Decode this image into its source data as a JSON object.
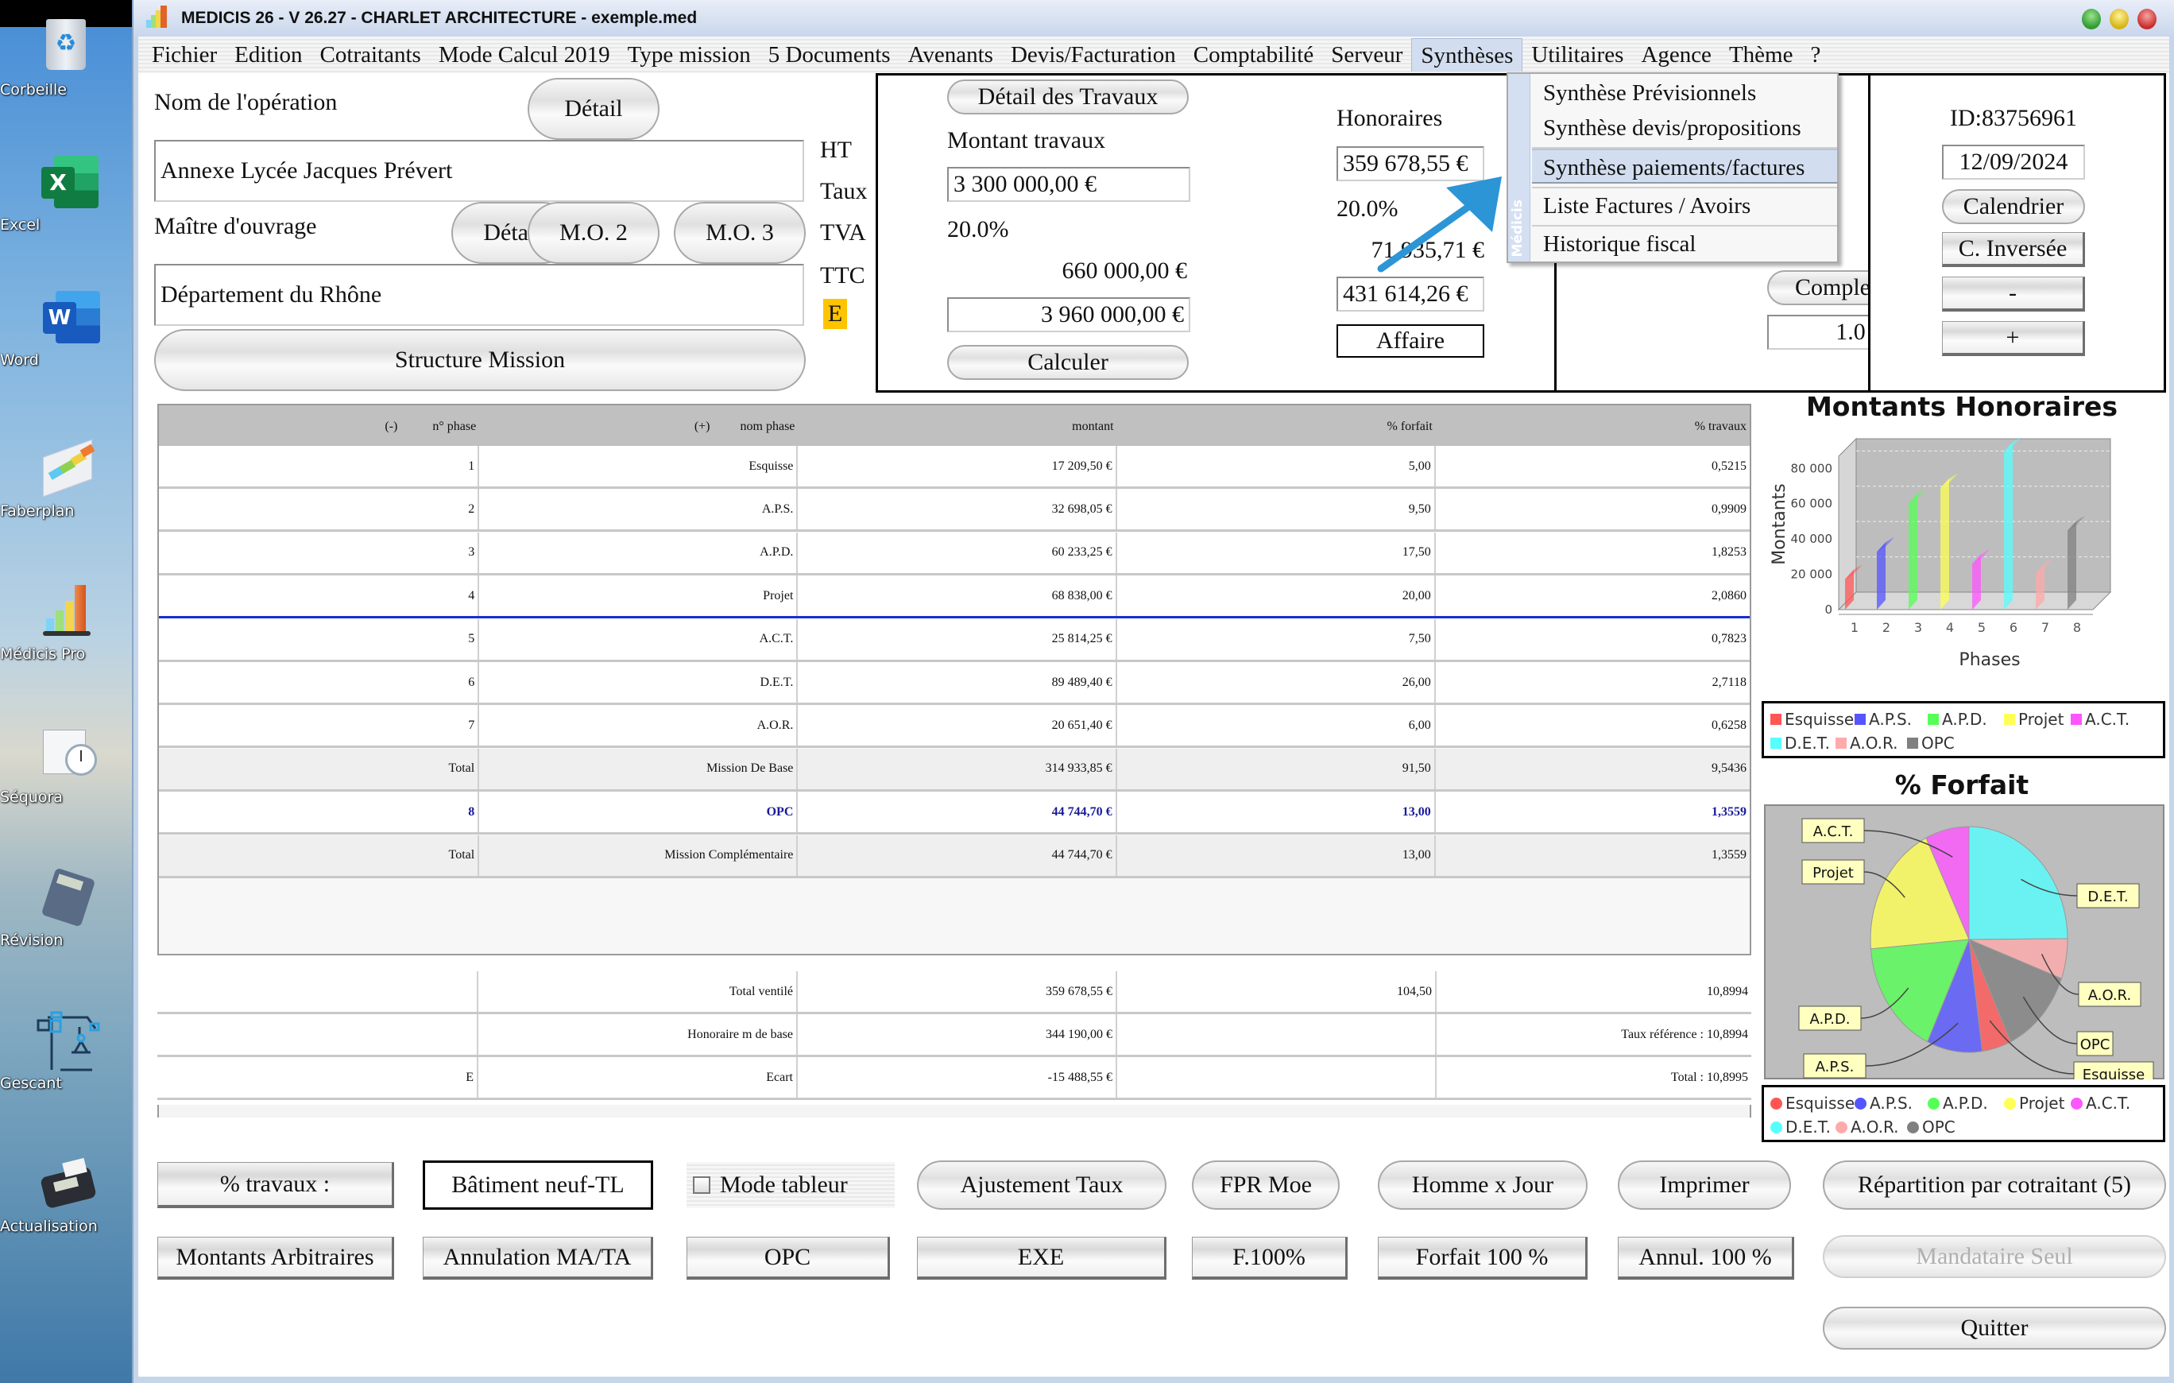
{
  "desktop": {
    "icons": [
      {
        "label": "Corbeille",
        "icon": "recycle-bin-icon"
      },
      {
        "label": "Excel",
        "icon": "excel-icon"
      },
      {
        "label": "Word",
        "icon": "word-icon"
      },
      {
        "label": "Faberplan",
        "icon": "faberplan-icon"
      },
      {
        "label": "Médicis Pro",
        "icon": "medicis-pro-icon"
      },
      {
        "label": "Séquora",
        "icon": "sequora-icon"
      },
      {
        "label": "Révision",
        "icon": "calculator-icon"
      },
      {
        "label": "Gescant",
        "icon": "crane-icon"
      },
      {
        "label": "Actualisation",
        "icon": "payment-terminal-icon"
      }
    ]
  },
  "window": {
    "title": "MEDICIS 26  - V 26.27 - CHARLET ARCHITECTURE - exemple.med",
    "controls": {
      "minimize_color": "#3fa83f",
      "maximize_color": "#e8c51a",
      "close_color": "#d93a3a"
    }
  },
  "menubar": {
    "items": [
      "Fichier",
      "Edition",
      "Cotraitants",
      "Mode Calcul 2019",
      "Type mission",
      "5 Documents",
      "Avenants",
      "Devis/Facturation",
      "Comptabilité",
      "Serveur",
      "Synthèses",
      "Utilitaires",
      "Agence",
      "Thème",
      "?"
    ],
    "open_menu": "Synthèses"
  },
  "dropdown": {
    "side_label": "Médicis",
    "items": [
      {
        "label": "Synthèse Prévisionnels",
        "highlighted": false
      },
      {
        "label": "Synthèse devis/propositions",
        "highlighted": false
      },
      {
        "label": "Synthèse paiements/factures",
        "highlighted": true
      },
      {
        "label": "Liste Factures / Avoirs",
        "highlighted": false
      },
      {
        "label": "Historique fiscal",
        "highlighted": false
      }
    ]
  },
  "operation": {
    "name_label": "Nom de l'opération",
    "detail_label": "Détail",
    "name_value": "Annexe Lycée Jacques Prévert",
    "owner_label": "Maître d'ouvrage",
    "owner_detail_label": "Détail",
    "mo2_label": "M.O. 2",
    "mo3_label": "M.O. 3",
    "owner_value": "Département du Rhône",
    "structure_label": "Structure Mission"
  },
  "travaux": {
    "ht_label": "HT",
    "taux_label": "Taux",
    "tva_label": "TVA",
    "ttc_label": "TTC",
    "e_badge": "E",
    "e_badge_color": "#ffc400",
    "detail_button": "Détail des Travaux",
    "montant_label": "Montant travaux",
    "montant_ht": "3 300 000,00 €",
    "taux": "20.0%",
    "tva_amount": "660 000,00 €",
    "montant_ttc": "3 960 000,00 €",
    "calculer_button": "Calculer"
  },
  "honoraires": {
    "label": "Honoraires",
    "ht": "359 678,55 €",
    "taux": "20.0%",
    "tva": "71 935,71 €",
    "ttc": "431 614,26 €",
    "affaire_button": "Affaire",
    "hidden_ghost_1": "Esquisse",
    "hidden_ghost_2": "71 935,71 €",
    "hidden_ghost_3": "431 614,26 €"
  },
  "complexite": {
    "button": "Complexité",
    "value": "1.0"
  },
  "id_panel": {
    "id_text": "ID:83756961",
    "date": "12/09/2024",
    "calendrier_button": "Calendrier",
    "inverse_button": "C. Inversée",
    "minus_button": "-",
    "plus_button": "+"
  },
  "phase_table": {
    "headers": {
      "minus": "(-)",
      "num": "n° phase",
      "plus": "(+)",
      "name": "nom phase",
      "montant": "montant",
      "forfait": "% forfait",
      "travaux": "% travaux"
    },
    "rows": [
      {
        "num": "1",
        "name": "Esquisse",
        "montant": "17 209,50 €",
        "forfait": "5,00",
        "travaux": "0,5215",
        "type": "phase"
      },
      {
        "num": "2",
        "name": "A.P.S.",
        "montant": "32 698,05 €",
        "forfait": "9,50",
        "travaux": "0,9909",
        "type": "phase"
      },
      {
        "num": "3",
        "name": "A.P.D.",
        "montant": "60 233,25 €",
        "forfait": "17,50",
        "travaux": "1,8253",
        "type": "phase"
      },
      {
        "num": "4",
        "name": "Projet",
        "montant": "68 838,00 €",
        "forfait": "20,00",
        "travaux": "2,0860",
        "type": "phase"
      },
      {
        "num": "5",
        "name": "A.C.T.",
        "montant": "25 814,25 €",
        "forfait": "7,50",
        "travaux": "0,7823",
        "type": "phase"
      },
      {
        "num": "6",
        "name": "D.E.T.",
        "montant": "89 489,40 €",
        "forfait": "26,00",
        "travaux": "2,7118",
        "type": "phase"
      },
      {
        "num": "7",
        "name": "A.O.R.",
        "montant": "20 651,40 €",
        "forfait": "6,00",
        "travaux": "0,6258",
        "type": "phase"
      },
      {
        "num": "Total",
        "name": "Mission De Base",
        "montant": "314 933,85 €",
        "forfait": "91,50",
        "travaux": "9,5436",
        "type": "total"
      },
      {
        "num": "8",
        "name": "OPC",
        "montant": "44 744,70 €",
        "forfait": "13,00",
        "travaux": "1,3559",
        "type": "opc"
      },
      {
        "num": "Total",
        "name": "Mission Complémentaire",
        "montant": "44 744,70 €",
        "forfait": "13,00",
        "travaux": "1,3559",
        "type": "total"
      }
    ],
    "separator_color": "#1a2fd0"
  },
  "summary_table": {
    "rows": [
      {
        "c1": "",
        "c2": "Total ventilé",
        "c3": "359 678,55 €",
        "c4": "104,50",
        "c5": "10,8994"
      },
      {
        "c1": "",
        "c2": "Honoraire m de base",
        "c3": "344 190,00 €",
        "c4": "",
        "c5": "Taux référence : 10,8994"
      },
      {
        "c1": "E",
        "c2": "Ecart",
        "c3": "-15 488,55 €",
        "c4": "",
        "c5": "Total : 10,8995"
      }
    ]
  },
  "buttons": {
    "pct_travaux": "% travaux :",
    "batiment": "Bâtiment neuf-TL",
    "mode_tableur": "Mode tableur",
    "mode_tableur_checked": false,
    "ajustement": "Ajustement Taux",
    "fpr": "FPR Moe",
    "homme_jour": "Homme x Jour",
    "imprimer": "Imprimer",
    "repartition": "Répartition par cotraitant (5)",
    "montants_arb": "Montants Arbitraires",
    "annulation": "Annulation MA/TA",
    "opc": "OPC",
    "exe": "EXE",
    "f100": "F.100%",
    "forfait100": "Forfait 100 %",
    "annul100": "Annul. 100 %",
    "mandataire": "Mandataire Seul",
    "quitter": "Quitter"
  },
  "chart_data": [
    {
      "type": "bar",
      "title": "Montants Honoraires",
      "xlabel": "Phases",
      "ylabel": "Montants",
      "categories": [
        "1",
        "2",
        "3",
        "4",
        "5",
        "6",
        "7",
        "8"
      ],
      "series_names": [
        "Esquisse",
        "A.P.S.",
        "A.P.D.",
        "Projet",
        "A.C.T.",
        "D.E.T.",
        "A.O.R.",
        "OPC"
      ],
      "values": [
        17209.5,
        32698.05,
        60233.25,
        68838.0,
        25814.25,
        89489.4,
        20651.4,
        44744.7
      ],
      "colors": [
        "#ff5555",
        "#5555ff",
        "#55ff55",
        "#ffff55",
        "#ff55ff",
        "#55ffff",
        "#ffaaaa",
        "#808080"
      ],
      "yticks": [
        "0",
        "20 000",
        "40 000",
        "60 000",
        "80 000"
      ],
      "ytick_values": [
        0,
        20000,
        40000,
        60000,
        80000
      ],
      "ylim": [
        0,
        95000
      ],
      "grid": true,
      "legend": [
        "Esquisse",
        "A.P.S.",
        "A.P.D.",
        "Projet",
        "A.C.T.",
        "D.E.T.",
        "A.O.R.",
        "OPC"
      ],
      "legend_position": "bottom"
    },
    {
      "type": "pie",
      "title": "% Forfait",
      "labels": [
        "Esquisse",
        "A.P.S.",
        "A.P.D.",
        "Projet",
        "A.C.T.",
        "D.E.T.",
        "A.O.R.",
        "OPC"
      ],
      "values": [
        5.0,
        9.5,
        17.5,
        20.0,
        7.5,
        26.0,
        6.0,
        13.0
      ],
      "colors": [
        "#ff5555",
        "#5555ff",
        "#55ff55",
        "#ffff55",
        "#ff55ff",
        "#55ffff",
        "#ffaaaa",
        "#808080"
      ],
      "legend": [
        "Esquisse",
        "A.P.S.",
        "A.P.D.",
        "Projet",
        "A.C.T.",
        "D.E.T.",
        "A.O.R.",
        "OPC"
      ],
      "legend_position": "bottom"
    }
  ]
}
